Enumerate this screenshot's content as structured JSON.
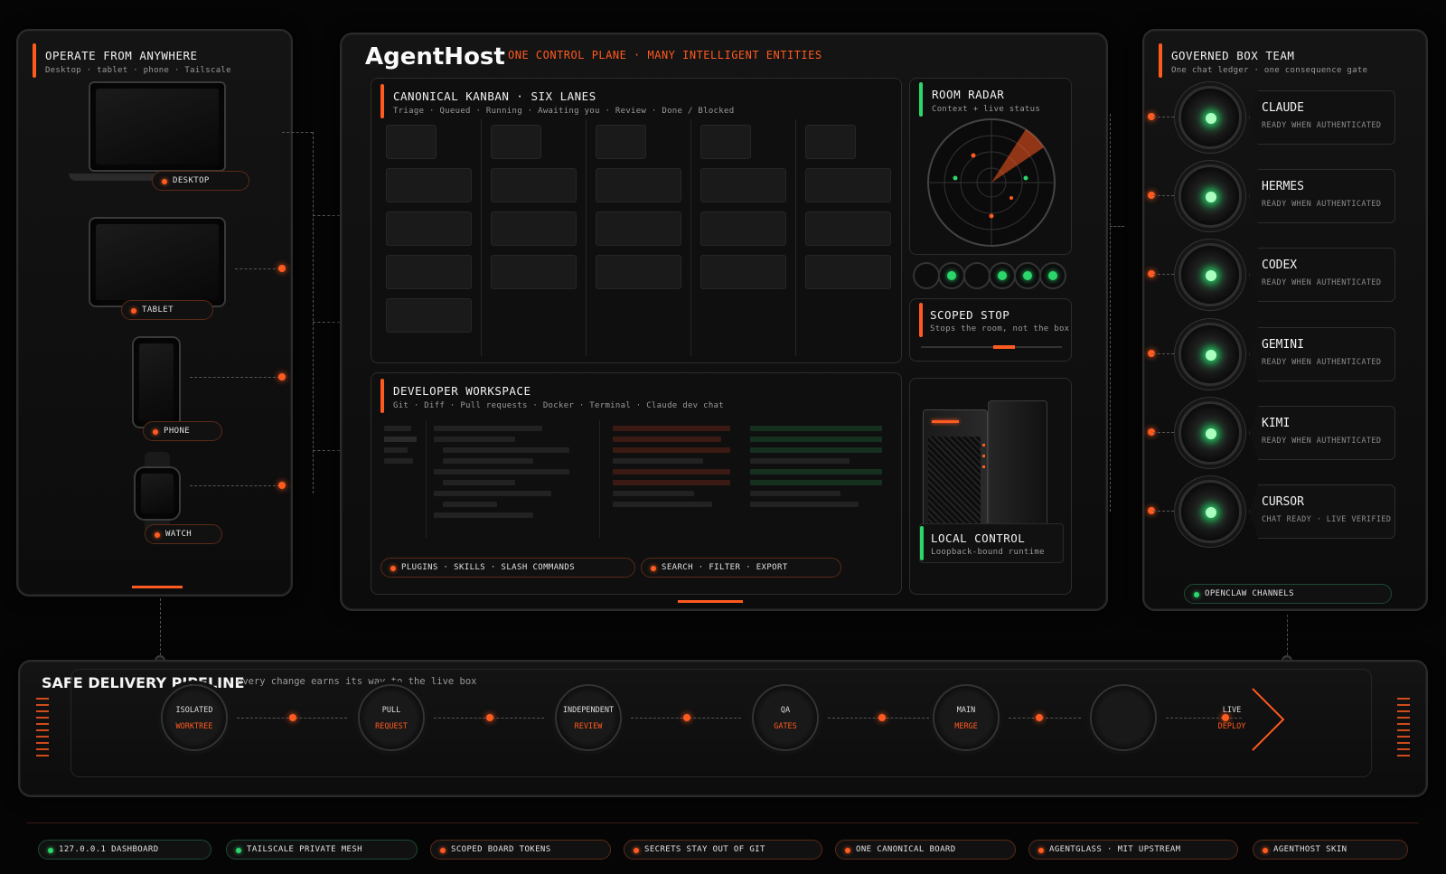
{
  "brand": {
    "name": "AgentHost",
    "tagline": "ONE CONTROL PLANE · MANY INTELLIGENT ENTITIES"
  },
  "left_panel": {
    "title": "OPERATE FROM ANYWHERE",
    "subtitle": "Desktop · tablet · phone · Tailscale",
    "devices": [
      {
        "label": "DESKTOP"
      },
      {
        "label": "TABLET"
      },
      {
        "label": "PHONE"
      },
      {
        "label": "WATCH"
      }
    ]
  },
  "kanban": {
    "title": "CANONICAL KANBAN · SIX LANES",
    "subtitle": "Triage · Queued · Running · Awaiting you · Review · Done / Blocked"
  },
  "radar": {
    "title": "ROOM RADAR",
    "subtitle": "Context + live status"
  },
  "scoped_stop": {
    "title": "SCOPED STOP",
    "subtitle": "Stops the room, not the box"
  },
  "workspace": {
    "title": "DEVELOPER WORKSPACE",
    "subtitle": "Git · Diff · Pull requests · Docker · Terminal · Claude dev chat",
    "pill_left": "PLUGINS · SKILLS · SLASH COMMANDS",
    "pill_right": "SEARCH · FILTER · EXPORT"
  },
  "local_control": {
    "title": "LOCAL CONTROL",
    "subtitle": "Loopback-bound runtime"
  },
  "right_panel": {
    "title": "GOVERNED BOX TEAM",
    "subtitle": "One chat ledger · one consequence gate",
    "agents": [
      {
        "name": "CLAUDE",
        "status": "READY WHEN AUTHENTICATED"
      },
      {
        "name": "HERMES",
        "status": "READY WHEN AUTHENTICATED"
      },
      {
        "name": "CODEX",
        "status": "READY WHEN AUTHENTICATED"
      },
      {
        "name": "GEMINI",
        "status": "READY WHEN AUTHENTICATED"
      },
      {
        "name": "KIMI",
        "status": "READY WHEN AUTHENTICATED"
      },
      {
        "name": "CURSOR",
        "status": "CHAT READY · LIVE VERIFIED"
      }
    ],
    "channels": "OPENCLAW CHANNELS"
  },
  "pipeline": {
    "title": "SAFE DELIVERY PIPELINE",
    "subtitle": "every change earns its way to the live box",
    "stages": [
      {
        "line1": "ISOLATED",
        "line2": "WORKTREE"
      },
      {
        "line1": "PULL",
        "line2": "REQUEST"
      },
      {
        "line1": "INDEPENDENT",
        "line2": "REVIEW"
      },
      {
        "line1": "QA",
        "line2": "GATES"
      },
      {
        "line1": "MAIN",
        "line2": "MERGE"
      },
      {
        "line1": "LIVE",
        "line2": "DEPLOY"
      }
    ]
  },
  "footer": {
    "items": [
      {
        "label": "127.0.0.1 DASHBOARD",
        "tone": "green"
      },
      {
        "label": "TAILSCALE PRIVATE MESH",
        "tone": "green"
      },
      {
        "label": "SCOPED BOARD TOKENS",
        "tone": "orange"
      },
      {
        "label": "SECRETS STAY OUT OF GIT",
        "tone": "orange"
      },
      {
        "label": "ONE CANONICAL BOARD",
        "tone": "orange"
      },
      {
        "label": "AGENTGLASS · MIT UPSTREAM",
        "tone": "orange"
      },
      {
        "label": "AGENTHOST SKIN",
        "tone": "orange"
      }
    ]
  },
  "colors": {
    "accent": "#ff5a1f",
    "ok": "#2bd66a",
    "bg": "#050505"
  }
}
